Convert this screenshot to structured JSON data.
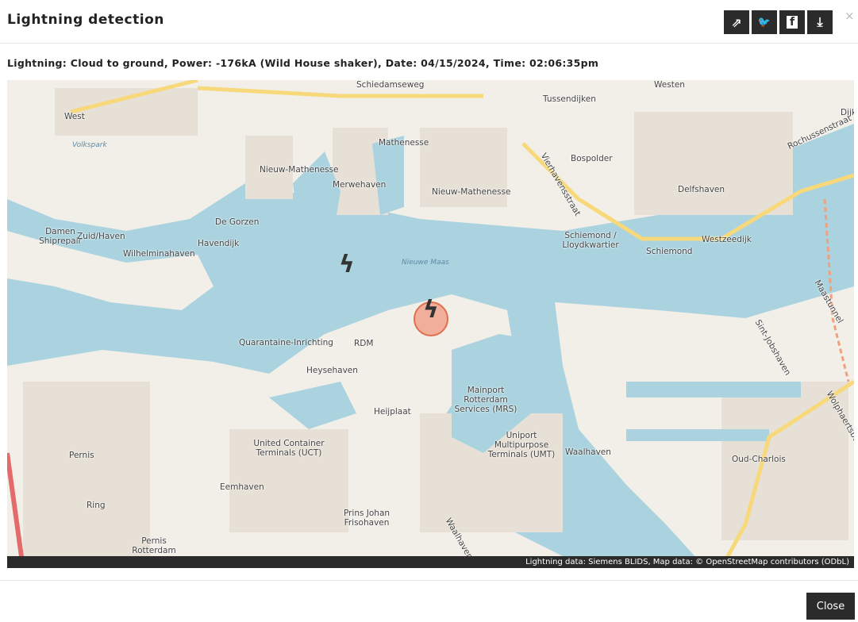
{
  "header": {
    "title": "Lightning detection",
    "close_x": "×"
  },
  "buttons": [
    {
      "name": "share",
      "glyph": "⇗"
    },
    {
      "name": "twitter",
      "glyph": "🐦"
    },
    {
      "name": "facebook",
      "glyph": "f"
    },
    {
      "name": "download",
      "glyph": "⤓"
    }
  ],
  "info": "Lightning: Cloud to ground, Power: -176kA (Wild House shaker), Date: 04/15/2024, Time: 02:06:35pm",
  "map": {
    "labels": [
      "Schiedamseweg",
      "Tussendijken",
      "West",
      "Volkspark",
      "Mathenesse",
      "Nieuw-Mathenesse",
      "Merwehaven",
      "Nieuw-Mathenesse",
      "Bospolder",
      "Vierhavensstraat",
      "Rochussenstraat",
      "Delfshaven",
      "De Gorzen",
      "Damen Shiprepair",
      "Zuid/Haven",
      "Wilhelminahaven",
      "Havendijk",
      "Schiemond / Lloydkwartier",
      "Schiemond",
      "Westzeedijk",
      "Nieuwe Maas",
      "Quarantaine-Inrichting",
      "RDM",
      "Heysehaven",
      "Heijplaat",
      "Mainport Rotterdam Services (MRS)",
      "Uniport Multipurpose Terminals (UMT)",
      "Waalhaven",
      "United Container Terminals (UCT)",
      "Eemhaven",
      "Pernis",
      "Ring",
      "Prins Johan Frisohaven",
      "Pernis Rotterdam",
      "Oud-Charlois",
      "Maastunnel",
      "Wolphaertsbocht",
      "Waalhavenweg",
      "Sint-Jobshaven",
      "Westen",
      "Dijk"
    ],
    "attribution": "Lightning data: Siemens BLIDS, Map data: © OpenStreetMap contributors (ODbL)"
  },
  "footer": {
    "close_label": "Close"
  },
  "colors": {
    "water": "#aad3df",
    "land": "#f2efe9",
    "industrial": "#ebdbe8",
    "road": "#f7d87a",
    "dark": "#2b2b2b",
    "marker": "#e0704f"
  }
}
